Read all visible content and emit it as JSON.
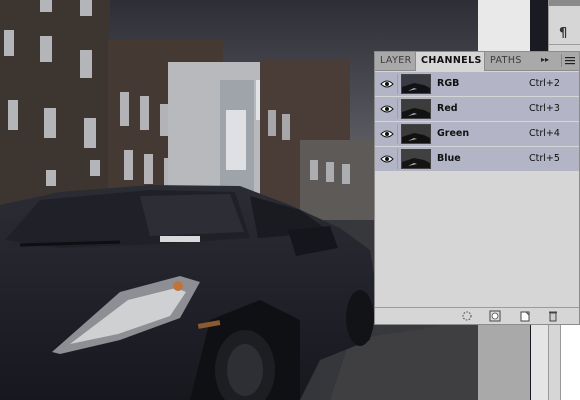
{
  "panel": {
    "tabs": [
      {
        "label": "LAYER"
      },
      {
        "label": "CHANNELS"
      },
      {
        "label": "PATHS"
      }
    ],
    "active_tab": "CHANNELS",
    "collapse_glyph": "▸▸",
    "channels": [
      {
        "name": "RGB",
        "shortcut": "Ctrl+2",
        "visible": true
      },
      {
        "name": "Red",
        "shortcut": "Ctrl+3",
        "visible": true
      },
      {
        "name": "Green",
        "shortcut": "Ctrl+4",
        "visible": true
      },
      {
        "name": "Blue",
        "shortcut": "Ctrl+5",
        "visible": true
      }
    ],
    "footer_icons": [
      "dotted-circle-icon",
      "mask-icon",
      "new-channel-icon",
      "trash-icon"
    ]
  },
  "dock": {
    "paragraph_glyph": "¶"
  },
  "colors": {
    "panel_bg": "#d6d6d6",
    "row_selected": "#b3b5c7",
    "tabbar": "#a9a9a9"
  }
}
